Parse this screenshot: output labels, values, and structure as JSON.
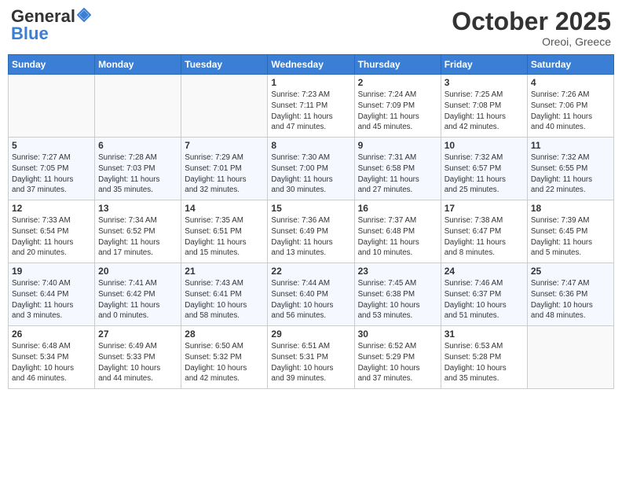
{
  "header": {
    "logo_general": "General",
    "logo_blue": "Blue",
    "month_title": "October 2025",
    "location": "Oreoi, Greece"
  },
  "weekdays": [
    "Sunday",
    "Monday",
    "Tuesday",
    "Wednesday",
    "Thursday",
    "Friday",
    "Saturday"
  ],
  "weeks": [
    [
      {
        "day": "",
        "info": ""
      },
      {
        "day": "",
        "info": ""
      },
      {
        "day": "",
        "info": ""
      },
      {
        "day": "1",
        "info": "Sunrise: 7:23 AM\nSunset: 7:11 PM\nDaylight: 11 hours\nand 47 minutes."
      },
      {
        "day": "2",
        "info": "Sunrise: 7:24 AM\nSunset: 7:09 PM\nDaylight: 11 hours\nand 45 minutes."
      },
      {
        "day": "3",
        "info": "Sunrise: 7:25 AM\nSunset: 7:08 PM\nDaylight: 11 hours\nand 42 minutes."
      },
      {
        "day": "4",
        "info": "Sunrise: 7:26 AM\nSunset: 7:06 PM\nDaylight: 11 hours\nand 40 minutes."
      }
    ],
    [
      {
        "day": "5",
        "info": "Sunrise: 7:27 AM\nSunset: 7:05 PM\nDaylight: 11 hours\nand 37 minutes."
      },
      {
        "day": "6",
        "info": "Sunrise: 7:28 AM\nSunset: 7:03 PM\nDaylight: 11 hours\nand 35 minutes."
      },
      {
        "day": "7",
        "info": "Sunrise: 7:29 AM\nSunset: 7:01 PM\nDaylight: 11 hours\nand 32 minutes."
      },
      {
        "day": "8",
        "info": "Sunrise: 7:30 AM\nSunset: 7:00 PM\nDaylight: 11 hours\nand 30 minutes."
      },
      {
        "day": "9",
        "info": "Sunrise: 7:31 AM\nSunset: 6:58 PM\nDaylight: 11 hours\nand 27 minutes."
      },
      {
        "day": "10",
        "info": "Sunrise: 7:32 AM\nSunset: 6:57 PM\nDaylight: 11 hours\nand 25 minutes."
      },
      {
        "day": "11",
        "info": "Sunrise: 7:32 AM\nSunset: 6:55 PM\nDaylight: 11 hours\nand 22 minutes."
      }
    ],
    [
      {
        "day": "12",
        "info": "Sunrise: 7:33 AM\nSunset: 6:54 PM\nDaylight: 11 hours\nand 20 minutes."
      },
      {
        "day": "13",
        "info": "Sunrise: 7:34 AM\nSunset: 6:52 PM\nDaylight: 11 hours\nand 17 minutes."
      },
      {
        "day": "14",
        "info": "Sunrise: 7:35 AM\nSunset: 6:51 PM\nDaylight: 11 hours\nand 15 minutes."
      },
      {
        "day": "15",
        "info": "Sunrise: 7:36 AM\nSunset: 6:49 PM\nDaylight: 11 hours\nand 13 minutes."
      },
      {
        "day": "16",
        "info": "Sunrise: 7:37 AM\nSunset: 6:48 PM\nDaylight: 11 hours\nand 10 minutes."
      },
      {
        "day": "17",
        "info": "Sunrise: 7:38 AM\nSunset: 6:47 PM\nDaylight: 11 hours\nand 8 minutes."
      },
      {
        "day": "18",
        "info": "Sunrise: 7:39 AM\nSunset: 6:45 PM\nDaylight: 11 hours\nand 5 minutes."
      }
    ],
    [
      {
        "day": "19",
        "info": "Sunrise: 7:40 AM\nSunset: 6:44 PM\nDaylight: 11 hours\nand 3 minutes."
      },
      {
        "day": "20",
        "info": "Sunrise: 7:41 AM\nSunset: 6:42 PM\nDaylight: 11 hours\nand 0 minutes."
      },
      {
        "day": "21",
        "info": "Sunrise: 7:43 AM\nSunset: 6:41 PM\nDaylight: 10 hours\nand 58 minutes."
      },
      {
        "day": "22",
        "info": "Sunrise: 7:44 AM\nSunset: 6:40 PM\nDaylight: 10 hours\nand 56 minutes."
      },
      {
        "day": "23",
        "info": "Sunrise: 7:45 AM\nSunset: 6:38 PM\nDaylight: 10 hours\nand 53 minutes."
      },
      {
        "day": "24",
        "info": "Sunrise: 7:46 AM\nSunset: 6:37 PM\nDaylight: 10 hours\nand 51 minutes."
      },
      {
        "day": "25",
        "info": "Sunrise: 7:47 AM\nSunset: 6:36 PM\nDaylight: 10 hours\nand 48 minutes."
      }
    ],
    [
      {
        "day": "26",
        "info": "Sunrise: 6:48 AM\nSunset: 5:34 PM\nDaylight: 10 hours\nand 46 minutes."
      },
      {
        "day": "27",
        "info": "Sunrise: 6:49 AM\nSunset: 5:33 PM\nDaylight: 10 hours\nand 44 minutes."
      },
      {
        "day": "28",
        "info": "Sunrise: 6:50 AM\nSunset: 5:32 PM\nDaylight: 10 hours\nand 42 minutes."
      },
      {
        "day": "29",
        "info": "Sunrise: 6:51 AM\nSunset: 5:31 PM\nDaylight: 10 hours\nand 39 minutes."
      },
      {
        "day": "30",
        "info": "Sunrise: 6:52 AM\nSunset: 5:29 PM\nDaylight: 10 hours\nand 37 minutes."
      },
      {
        "day": "31",
        "info": "Sunrise: 6:53 AM\nSunset: 5:28 PM\nDaylight: 10 hours\nand 35 minutes."
      },
      {
        "day": "",
        "info": ""
      }
    ]
  ]
}
